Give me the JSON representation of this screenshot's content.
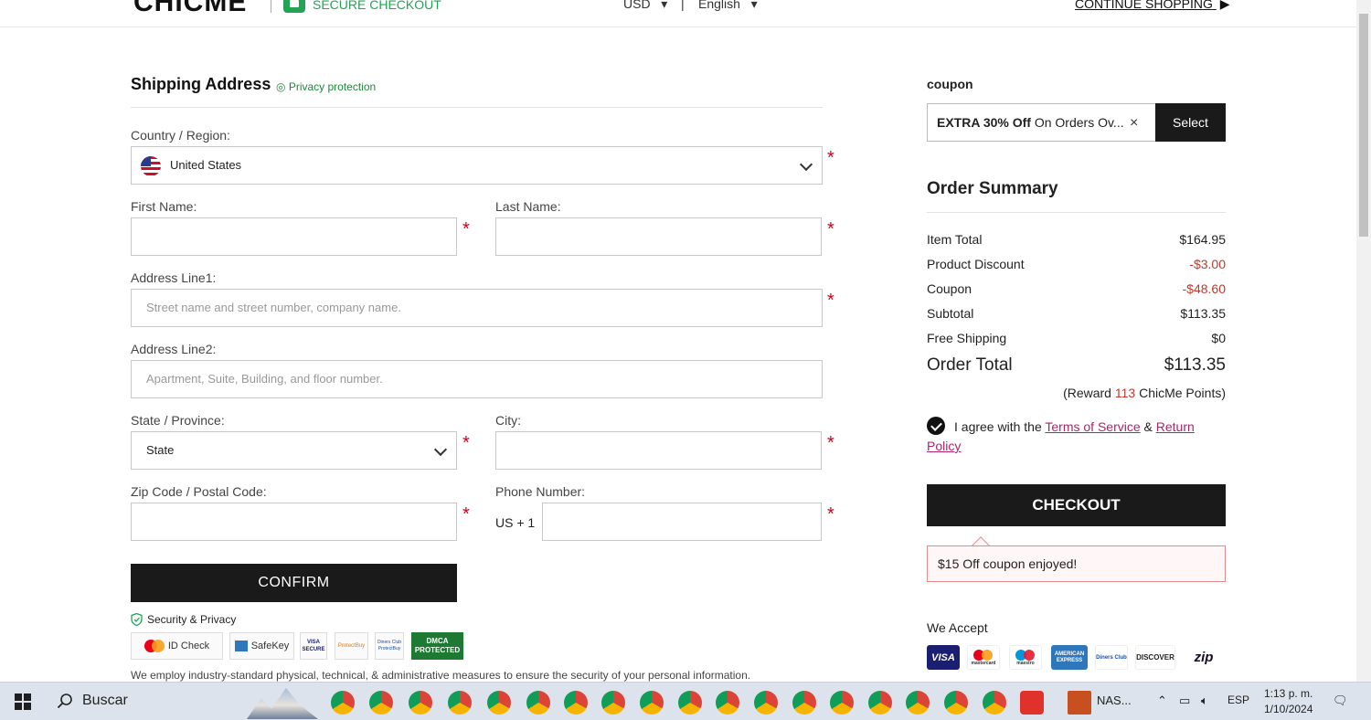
{
  "header": {
    "logo": "CHICME",
    "secure_checkout": "SECURE CHECKOUT",
    "currency": "USD",
    "language": "English",
    "continue_shopping": "CONTINUE SHOPPING"
  },
  "shipping": {
    "title": "Shipping Address",
    "privacy": "Privacy protection",
    "country_label": "Country / Region:",
    "country_value": "United States",
    "first_name_label": "First Name:",
    "last_name_label": "Last Name:",
    "address1_label": "Address Line1:",
    "address1_placeholder": "Street name and street number, company name.",
    "address2_label": "Address Line2:",
    "address2_placeholder": "Apartment, Suite, Building, and floor number.",
    "state_label": "State / Province:",
    "state_value": "State",
    "city_label": "City:",
    "zip_label": "Zip Code / Postal Code:",
    "phone_label": "Phone Number:",
    "phone_prefix": "US + 1",
    "required_mark": "*",
    "confirm": "CONFIRM",
    "security_title": "Security & Privacy",
    "badges": [
      "ID Check",
      "SafeKey",
      "VISA SECURE",
      "ProtectBuy",
      "Diners Club ProtectBuy",
      "DMCA PROTECTED"
    ],
    "disclaimer": "We employ industry-standard physical, technical, & administrative measures to ensure the security of your personal information."
  },
  "coupon": {
    "label": "coupon",
    "value_bold": "EXTRA 30% Off",
    "value_rest": " On Orders Ov...",
    "clear_icon": "×",
    "select": "Select"
  },
  "summary": {
    "title": "Order Summary",
    "rows": [
      {
        "label": "Item Total",
        "value": "$164.95"
      },
      {
        "label": "Product Discount",
        "value": "-$3.00"
      },
      {
        "label": "Coupon",
        "value": "-$48.60"
      },
      {
        "label": "Subtotal",
        "value": "$113.35"
      },
      {
        "label": "Free Shipping",
        "value": "$0"
      }
    ],
    "total_label": "Order Total",
    "total_value": "$113.35",
    "reward_prefix": "(Reward ",
    "reward_points": "113",
    "reward_suffix": " ChicMe Points)",
    "agree_text": "I agree with the ",
    "terms": "Terms of Service",
    "amp": " & ",
    "return_policy": "Return Policy",
    "checkout": "CHECKOUT",
    "toast": "$15 Off coupon enjoyed!",
    "we_accept": "We Accept",
    "cards": [
      "VISA",
      "mastercard",
      "maestro",
      "AMERICAN EXPRESS",
      "Diners Club",
      "DISCOVER",
      "zip"
    ]
  },
  "taskbar": {
    "search": "Buscar",
    "nas_label": "NAS...",
    "lang": "ESP",
    "time": "1:13 p. m.",
    "date": "1/10/2024"
  },
  "colors": {
    "accent_green": "#23a455",
    "required_red": "#d0021b",
    "link_magenta": "#b0226b",
    "dark_button": "#1a1a1a"
  }
}
